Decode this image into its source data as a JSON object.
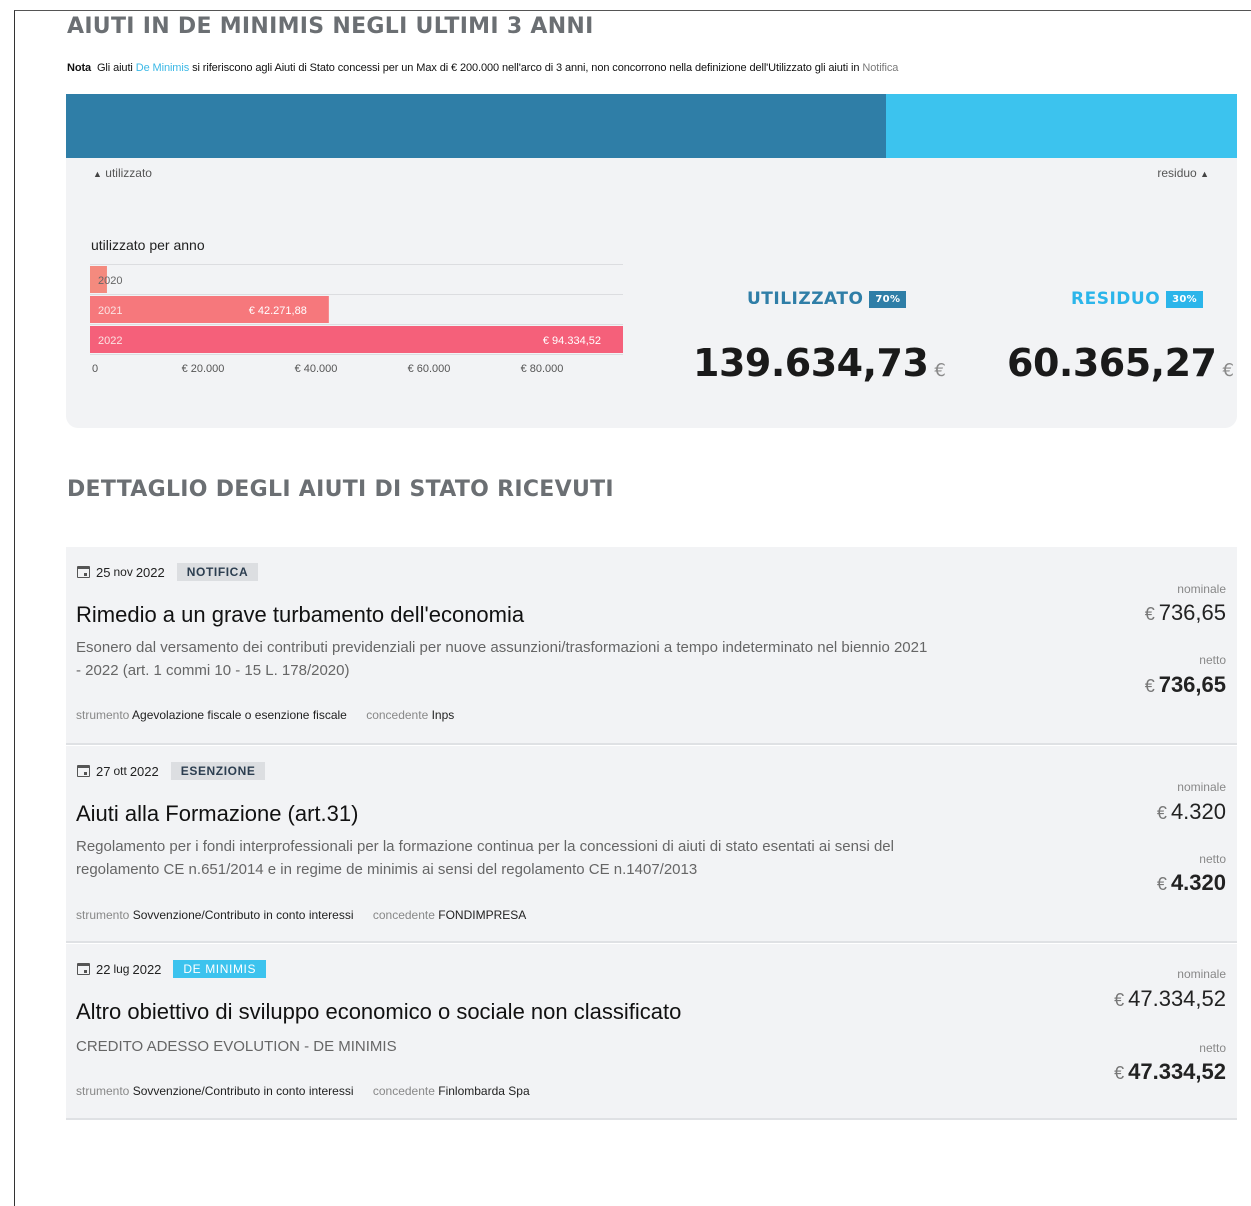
{
  "header": {
    "title": "AIUTI IN DE MINIMIS NEGLI ULTIMI 3 ANNI",
    "note_prefix": "Nota",
    "note_text_1": "Gli aiuti",
    "note_link": "De Minimis",
    "note_text_2": "si riferiscono agli Aiuti di Stato concessi per un Max di € 200.000 nell'arco di 3 anni, non concorrono nella definizione dell'Utilizzato gli aiuti in",
    "note_link_2": "Notifica"
  },
  "summary": {
    "used_fraction": 0.7,
    "used_marker": "utilizzato",
    "residual_marker": "residuo",
    "per_year_title": "utilizzato per anno",
    "used_label": "UTILIZZATO",
    "used_pct": "70%",
    "used_value": "139.634,73",
    "residual_label": "RESIDUO",
    "residual_pct": "30%",
    "residual_value": "60.365,27",
    "currency": "€",
    "colors": {
      "used": "#2f7ea7",
      "residual": "#3cc3ee"
    }
  },
  "chart_data": {
    "type": "bar",
    "orientation": "horizontal",
    "title": "utilizzato per anno",
    "categories": [
      "2020",
      "2021",
      "2022"
    ],
    "values": [
      3000,
      42271.88,
      94334.52
    ],
    "data_labels": [
      "",
      "€ 42.271,88",
      "€ 94.334,52"
    ],
    "xlim": [
      0,
      94334.52
    ],
    "x_ticks": [
      0,
      20000,
      40000,
      60000,
      80000
    ],
    "x_tick_labels": [
      "0",
      "€ 20.000",
      "€ 40.000",
      "€ 60.000",
      "€ 80.000"
    ],
    "colors": [
      "#f48a7e",
      "#f6787c",
      "#f5607a"
    ],
    "grid": true
  },
  "details": {
    "title": "DETTAGLIO DEGLI AIUTI DI STATO RICEVUTI",
    "nominal_label": "nominale",
    "net_label": "netto",
    "instrument_label": "strumento",
    "grantor_label": "concedente",
    "items": [
      {
        "day": "25",
        "month": "nov",
        "year": "2022",
        "tag": "NOTIFICA",
        "title": "Rimedio a un grave turbamento dell'economia",
        "description": "Esonero dal versamento dei contributi previdenziali per nuove assunzioni/trasformazioni a tempo indeterminato nel biennio 2021 - 2022 (art. 1 commi 10 - 15 L. 178/2020)",
        "instrument": "Agevolazione fiscale o esenzione fiscale",
        "grantor": "Inps",
        "nominal": "736,65",
        "net": "736,65"
      },
      {
        "day": "27",
        "month": "ott",
        "year": "2022",
        "tag": "ESENZIONE",
        "title": "Aiuti alla Formazione (art.31)",
        "description": "Regolamento per i fondi interprofessionali per la formazione continua per la concessioni di aiuti di stato esentati ai sensi del regolamento CE n.651/2014 e in regime de minimis ai sensi del regolamento CE n.1407/2013",
        "instrument": "Sovvenzione/Contributo in conto interessi",
        "grantor": "FONDIMPRESA",
        "nominal": "4.320",
        "net": "4.320"
      },
      {
        "day": "22",
        "month": "lug",
        "year": "2022",
        "tag": "DE MINIMIS",
        "title": "Altro obiettivo di sviluppo economico o sociale non classificato",
        "description": "CREDITO ADESSO EVOLUTION - DE MINIMIS",
        "instrument": "Sovvenzione/Contributo in conto interessi",
        "grantor": "Finlombarda Spa",
        "nominal": "47.334,52",
        "net": "47.334,52"
      }
    ]
  }
}
